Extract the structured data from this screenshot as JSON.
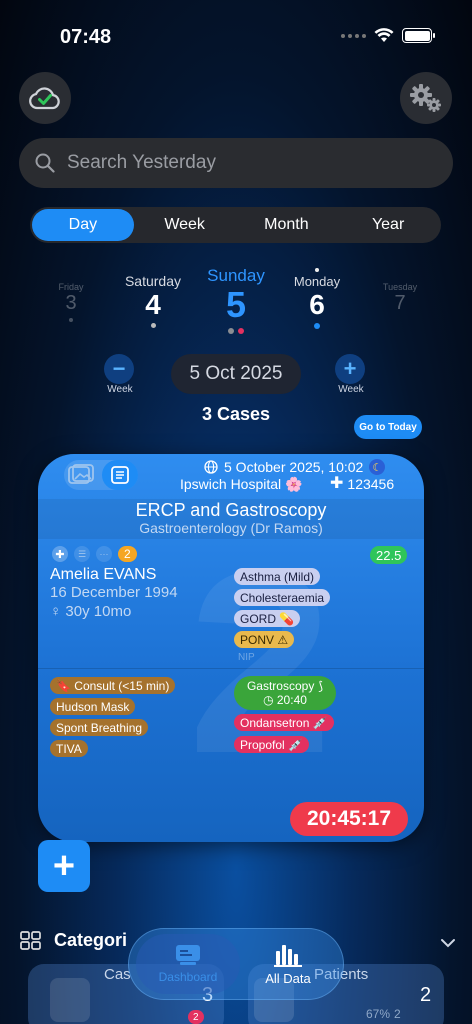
{
  "status": {
    "time": "07:48"
  },
  "search": {
    "placeholder": "Search Yesterday"
  },
  "segments": [
    "Day",
    "Week",
    "Month",
    "Year"
  ],
  "days": [
    {
      "name": "Friday",
      "num": "3"
    },
    {
      "name": "Saturday",
      "num": "4"
    },
    {
      "name": "Sunday",
      "num": "5"
    },
    {
      "name": "Monday",
      "num": "6"
    },
    {
      "name": "Tuesday",
      "num": "7"
    }
  ],
  "stepper": {
    "prev_label": "Week",
    "next_label": "Week",
    "prev_symbol": "−",
    "next_symbol": "+"
  },
  "date_pill": "5 Oct 2025",
  "cases_count": "3 Cases",
  "goto_today": "Go to Today",
  "card": {
    "datetime": "5 October 2025, 10:02",
    "hospital": "Ipswich Hospital 🌸",
    "mrn": "123456",
    "procedure": "ERCP and Gastroscopy",
    "specialty": "Gastroenterology (Dr Ramos)",
    "badge_count": "2",
    "score": "22.5",
    "patient_name": "Amelia EVANS",
    "dob": "16 December 1994",
    "age": "♀ 30y 10mo",
    "conditions": [
      {
        "label": "Asthma (Mild)",
        "style": "lav"
      },
      {
        "label": "Cholesteraemia",
        "style": "lav"
      },
      {
        "label": "GORD 💊",
        "style": "lav"
      },
      {
        "label": "PONV ⚠",
        "style": "yel"
      }
    ],
    "faded_condition": "NIP",
    "anaesthesia": [
      "🔖 Consult (<15 min)",
      "Hudson Mask",
      "Spont Breathing",
      "TIVA"
    ],
    "procedure_tag": "Gastroscopy",
    "procedure_time": "◷ 20:40",
    "drugs": [
      "Ondansetron 💉",
      "Propofol 💉"
    ],
    "timer": "20:45:17",
    "big_number": "2"
  },
  "categories": {
    "label": "Categori"
  },
  "tiles": {
    "cases_label": "Cas",
    "cases_badge": "2",
    "cases_num": "3",
    "patients_label": "Patients",
    "patients_num": "2",
    "patients_pct": "67%",
    "patients_sub": "2"
  },
  "tabbar": {
    "dashboard": "Dashboard",
    "all_data": "All Data"
  },
  "colors": {
    "accent": "#1e8cf5",
    "green": "#2fc55a",
    "red": "#e33160"
  }
}
